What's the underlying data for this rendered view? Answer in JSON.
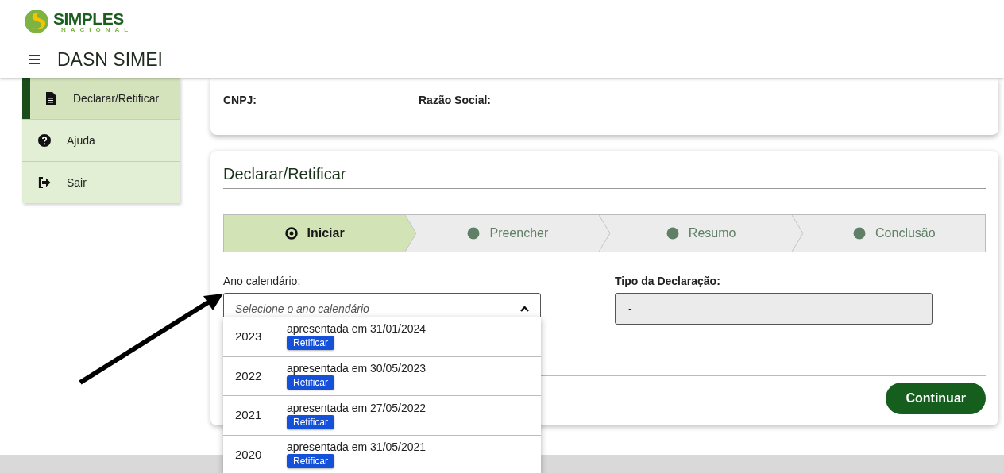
{
  "header": {
    "logo": {
      "name": "SIMPLES",
      "subtitle": "NACIONAL"
    },
    "title": "DASN SIMEI"
  },
  "sidebar": {
    "items": [
      {
        "kind": "document",
        "label": "Declarar/Retificar",
        "selected": true
      },
      {
        "kind": "help",
        "label": "Ajuda",
        "selected": false
      },
      {
        "kind": "exit",
        "label": "Sair",
        "selected": false
      }
    ]
  },
  "company_card": {
    "fields": [
      {
        "label": "CNPJ:"
      },
      {
        "label": "Razão Social:"
      }
    ]
  },
  "form": {
    "title": "Declarar/Retificar",
    "steps": [
      {
        "label": "Iniciar",
        "selected": true
      },
      {
        "label": "Preencher",
        "selected": false
      },
      {
        "label": "Resumo",
        "selected": false
      },
      {
        "label": "Conclusão",
        "selected": false
      }
    ],
    "year_field": {
      "label": "Ano calendário:",
      "placeholder": "Selecione o ano calendário",
      "expanded": true
    },
    "type_field": {
      "label": "Tipo da Declaração:",
      "value": "-",
      "disabled": true
    },
    "year_options": [
      {
        "year": "2023",
        "status": "apresentada em 31/01/2024",
        "action": "Retificar"
      },
      {
        "year": "2022",
        "status": "apresentada em 30/05/2023",
        "action": "Retificar"
      },
      {
        "year": "2021",
        "status": "apresentada em 27/05/2022",
        "action": "Retificar"
      },
      {
        "year": "2020",
        "status": "apresentada em 31/05/2021",
        "action": "Retificar"
      }
    ],
    "submit": "Continuar"
  }
}
